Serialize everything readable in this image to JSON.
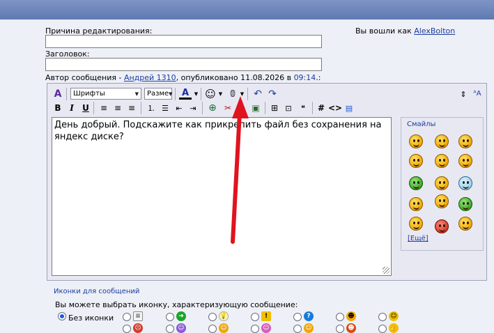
{
  "form": {
    "reason_label": "Причина редактирования:",
    "reason_value": "",
    "title_label": "Заголовок:",
    "title_value": "",
    "logged_in_prefix": "Вы вошли как",
    "logged_in_user": "AlexBolton",
    "author_prefix": "Автор сообщения -",
    "author_name": "Андрей 1310",
    "published_text": ", опубликовано 11.08.2026 в",
    "published_time": "09:14",
    "published_suffix": ".:"
  },
  "editor": {
    "font_select": "Шрифты",
    "size_select": "Разме",
    "message": "День добрый. Подскажите как прикрепить файл без сохранения на яндекс диске?",
    "smileys_title": "Смайлы",
    "more_smileys": "[Ещё]",
    "toolbar_icons": [
      "toggle-mode-icon",
      "font-color-icon",
      "smiley-icon",
      "attachment-icon",
      "undo-icon",
      "redo-icon",
      "resize-icon",
      "spellcheck-icon",
      "bold-icon",
      "italic-icon",
      "underline-icon",
      "align-left-icon",
      "align-center-icon",
      "align-right-icon",
      "ordered-list-icon",
      "unordered-list-icon",
      "outdent-icon",
      "indent-icon",
      "link-icon",
      "unlink-icon",
      "email-icon",
      "image-icon",
      "insert-icon",
      "quote-icon",
      "hash-icon",
      "code-icon",
      "spoiler-icon"
    ]
  },
  "icons_section": {
    "title": "Иконки для сообщений",
    "hint": "Вы можете выбрать иконку, характеризующую сообщение:",
    "no_icon_label": "Без иконки"
  },
  "colors": {
    "accent": "#1a3d9e",
    "header": "#5f79b2",
    "background": "#eef0f7",
    "arrow": "#e0141e"
  }
}
